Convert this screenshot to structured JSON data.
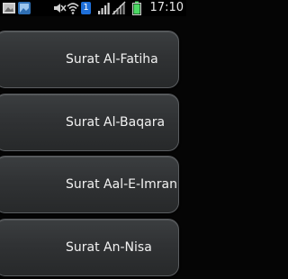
{
  "status_bar": {
    "time": "17:10",
    "icons": [
      "photo-icon",
      "image-icon",
      "mute-icon",
      "wifi-icon",
      "notification-count-badge",
      "signal-icon",
      "no-signal-icon",
      "battery-icon"
    ],
    "notification_count": "1"
  },
  "surah_list": {
    "items": [
      {
        "label": "Surat Al-Fatiha"
      },
      {
        "label": "Surat Al-Baqara"
      },
      {
        "label": "Surat Aal-E-Imran"
      },
      {
        "label": "Surat An-Nisa"
      }
    ]
  },
  "colors": {
    "background": "#050505",
    "item_background": "#303234",
    "item_border": "#5a5d60",
    "text": "#f2f2f2",
    "badge": "#1e6fd9"
  }
}
